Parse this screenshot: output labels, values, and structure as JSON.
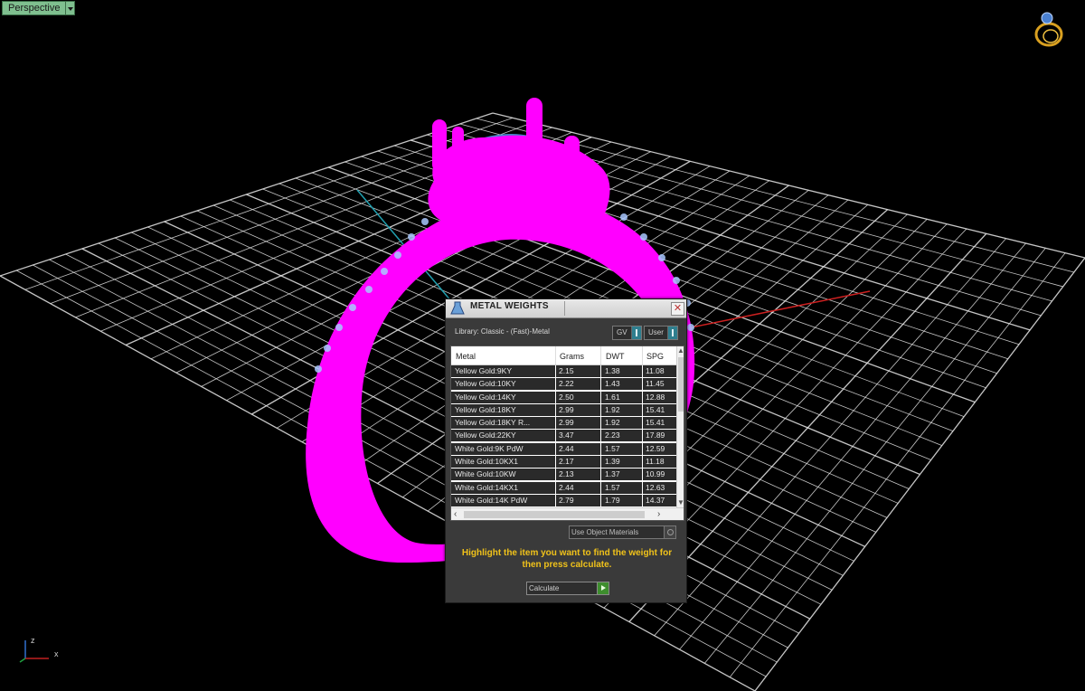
{
  "viewport": {
    "label": "Perspective",
    "axis_labels": {
      "z": "z",
      "x": "x"
    }
  },
  "dialog": {
    "title": "METAL WEIGHTS",
    "library": "Library: Classic - (Fast)-Metal",
    "toggle_gv": "GV",
    "toggle_user": "User",
    "columns": [
      "Metal",
      "Grams",
      "DWT",
      "SPG"
    ],
    "rows": [
      [
        "Yellow Gold:9KY",
        "2.15",
        "1.38",
        "11.08"
      ],
      [
        "Yellow Gold:10KY",
        "2.22",
        "1.43",
        "11.45"
      ],
      [
        "Yellow Gold:14KY",
        "2.50",
        "1.61",
        "12.88"
      ],
      [
        "Yellow Gold:18KY",
        "2.99",
        "1.92",
        "15.41"
      ],
      [
        "Yellow Gold:18KY R...",
        "2.99",
        "1.92",
        "15.41"
      ],
      [
        "Yellow Gold:22KY",
        "3.47",
        "2.23",
        "17.89"
      ],
      [
        "White Gold:9K PdW",
        "2.44",
        "1.57",
        "12.59"
      ],
      [
        "White Gold:10KX1",
        "2.17",
        "1.39",
        "11.18"
      ],
      [
        "White Gold:10KW",
        "2.13",
        "1.37",
        "10.99"
      ],
      [
        "White Gold:14KX1",
        "2.44",
        "1.57",
        "12.63"
      ],
      [
        "White Gold:14K PdW",
        "2.79",
        "1.79",
        "14.37"
      ]
    ],
    "use_object_materials": "Use Object Materials",
    "hint": "Highlight the item you want to find the weight for then press calculate.",
    "calculate_label": "Calculate"
  },
  "colors": {
    "ring": "#ff00ff",
    "gem": "#4a90d9",
    "grid": "#e8e8e8",
    "axis_red": "#cc2020",
    "axis_cyan": "#20a0b0",
    "hint_text": "#f0c21a",
    "viewport_tab": "#7fbf8f"
  }
}
